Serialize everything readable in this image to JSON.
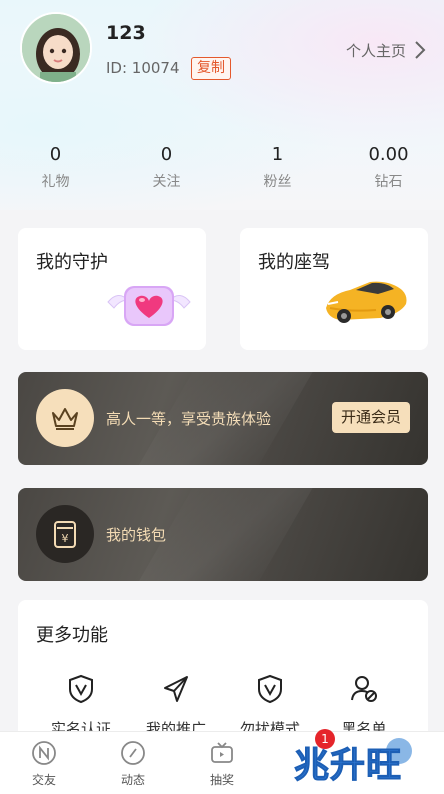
{
  "profile": {
    "username": "123",
    "id_text": "ID:  10074",
    "copy_label": "复制",
    "home_label": "个人主页"
  },
  "stats": [
    {
      "value": "0",
      "label": "礼物"
    },
    {
      "value": "0",
      "label": "关注"
    },
    {
      "value": "1",
      "label": "粉丝"
    },
    {
      "value": "0.00",
      "label": "钻石"
    }
  ],
  "cards": {
    "guard_title": "我的守护",
    "car_title": "我的座驾"
  },
  "vip": {
    "text": "高人一等，享受贵族体验",
    "button": "开通会员"
  },
  "wallet": {
    "text": "我的钱包"
  },
  "more": {
    "title": "更多功能",
    "items": [
      {
        "label": "实名认证",
        "icon": "verified-shield-icon"
      },
      {
        "label": "我的推广",
        "icon": "paper-plane-icon"
      },
      {
        "label": "勿扰模式",
        "icon": "shield-icon"
      },
      {
        "label": "黑名单",
        "icon": "user-block-icon"
      }
    ]
  },
  "tabbar": {
    "items": [
      {
        "label": "交友",
        "icon": "n-circle-icon"
      },
      {
        "label": "动态",
        "icon": "compass-icon"
      },
      {
        "label": "抽奖",
        "icon": "tv-icon"
      }
    ],
    "message_badge": "1"
  },
  "watermark": "兆升旺",
  "colors": {
    "accent_orange": "#e4592d",
    "vip_gold": "#f6dfbb",
    "dark_card": "#4a4743",
    "badge_red": "#e5252b"
  }
}
